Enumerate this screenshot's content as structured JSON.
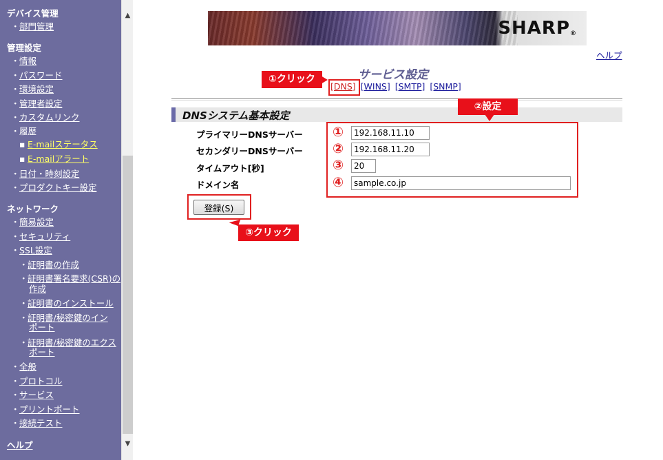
{
  "sidebar": {
    "device_mgmt": {
      "heading": "デバイス管理",
      "items": [
        "部門管理"
      ]
    },
    "admin_settings": {
      "heading": "管理設定",
      "items": [
        "情報",
        "パスワード",
        "環境設定",
        "管理者設定",
        "カスタムリンク",
        "履歴"
      ],
      "history_sub": [
        "E-mailステータス",
        "E-mailアラート"
      ],
      "items2": [
        "日付・時刻設定",
        "プロダクトキー設定"
      ]
    },
    "network": {
      "heading": "ネットワーク",
      "items": [
        "簡易設定",
        "セキュリティ",
        "SSL設定"
      ],
      "ssl_sub": [
        "証明書の作成",
        "証明書署名要求(CSR)の",
        "作成",
        "証明書のインストール",
        "証明書/秘密鍵のイン",
        "ポート",
        "証明書/秘密鍵のエクス",
        "ポート"
      ],
      "items2": [
        "全般",
        "プロトコル",
        "サービス",
        "プリントポート",
        "接続テスト"
      ]
    },
    "help": "ヘルプ"
  },
  "header": {
    "brand": "SHARP",
    "brand_mark": "R",
    "help_link": "ヘルプ",
    "page_title": "サービス設定"
  },
  "tabs": [
    {
      "label": "[DNS]",
      "active": true
    },
    {
      "label": "[WINS]"
    },
    {
      "label": "[SMTP]"
    },
    {
      "label": "[SNMP]"
    }
  ],
  "section": {
    "title": "DNSシステム基本設定"
  },
  "fields": [
    {
      "label": "プライマリーDNSサーバー",
      "value": "192.168.11.10",
      "marker": "①"
    },
    {
      "label": "セカンダリーDNSサーバー",
      "value": "192.168.11.20",
      "marker": "②"
    },
    {
      "label": "タイムアウト[秒]",
      "value": "20",
      "marker": "③"
    },
    {
      "label": "ドメイン名",
      "value": "sample.co.jp",
      "marker": "④"
    }
  ],
  "register_button": "登録(S)",
  "annotations": {
    "click1": "①クリック",
    "settings2": "②設定",
    "click3": "③クリック"
  },
  "colors": {
    "sidebar_bg": "#6d6c9e",
    "annotation_red": "#e8101a",
    "link_blue": "#1b1b9c"
  }
}
